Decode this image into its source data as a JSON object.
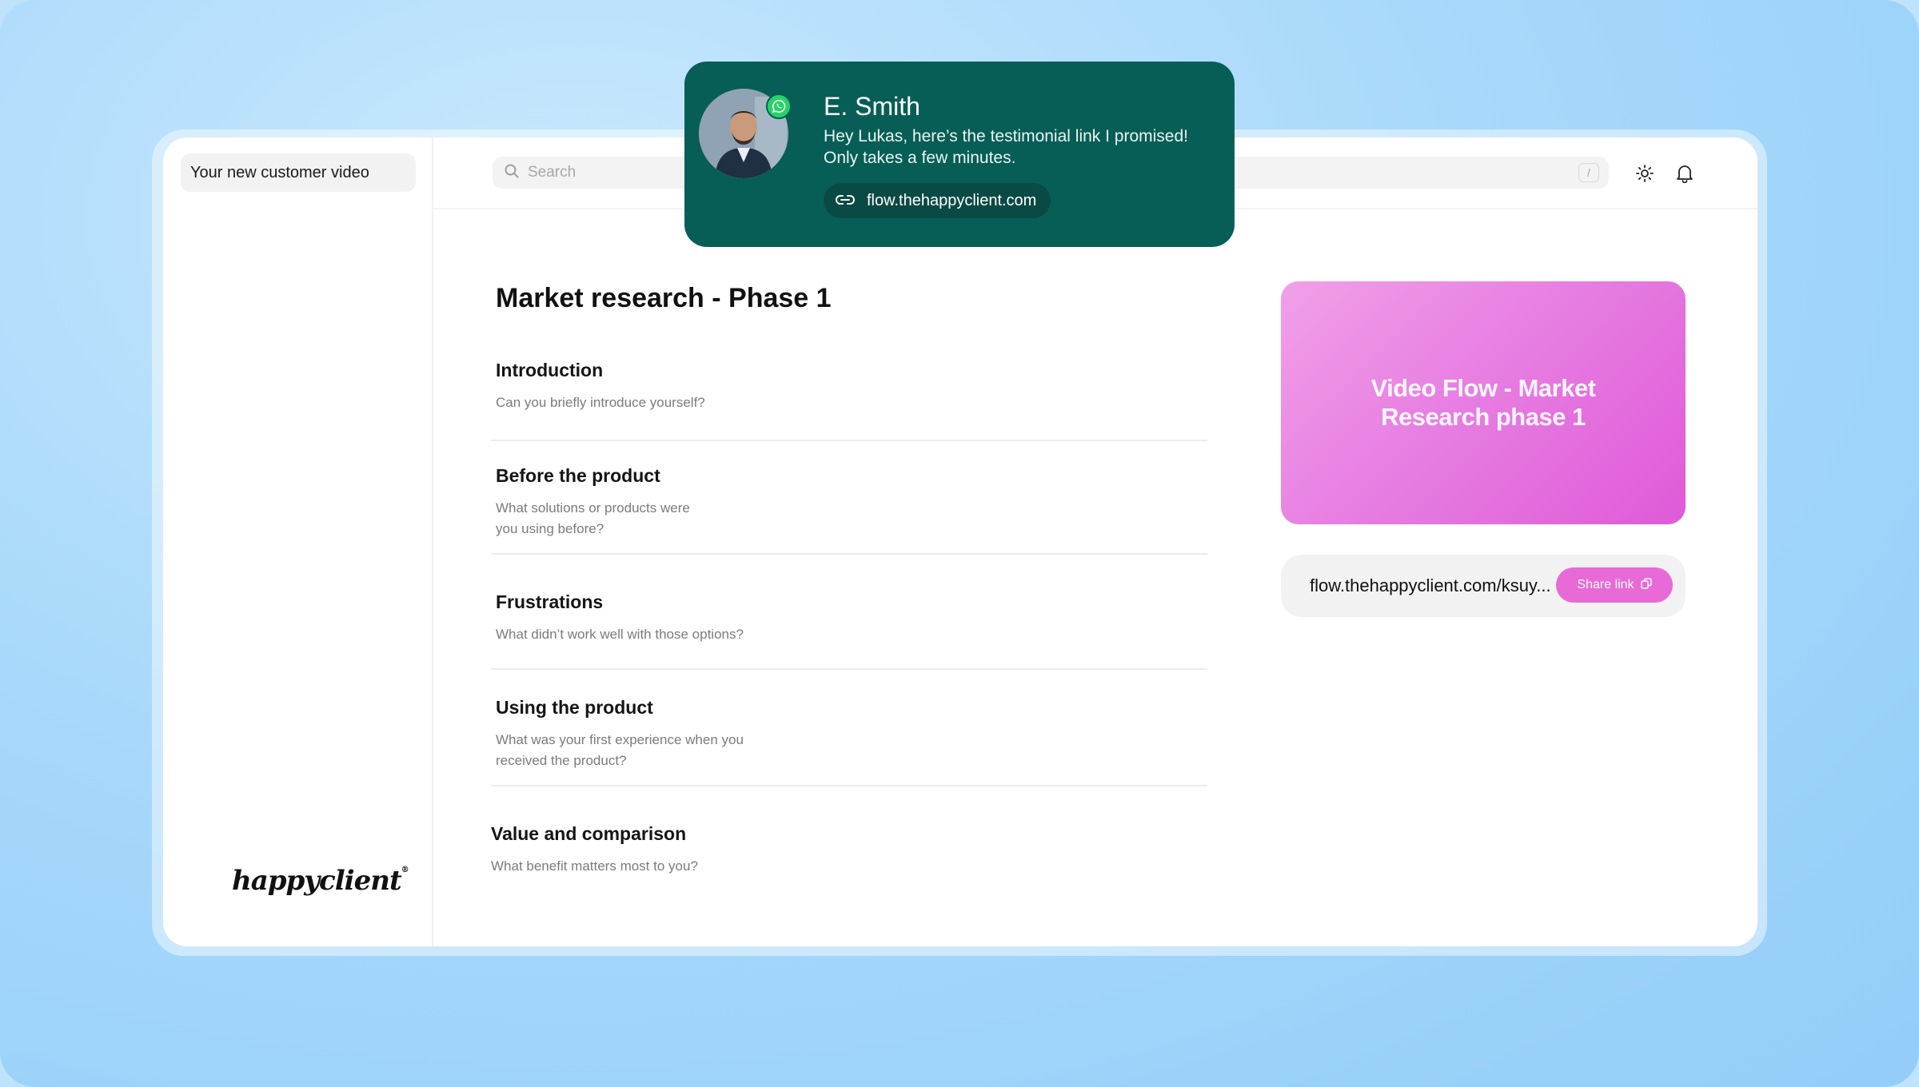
{
  "sidebar": {
    "workspace_label": "Your new customer video",
    "logo_text": "happyclient"
  },
  "topbar": {
    "search_placeholder": "Search",
    "shortcut_key": "/"
  },
  "main": {
    "title": "Market research - Phase 1",
    "sections": [
      {
        "heading": "Introduction",
        "question": "Can you briefly introduce yourself?"
      },
      {
        "heading": "Before the product",
        "question": "What solutions or products were\nyou using before?"
      },
      {
        "heading": "Frustrations",
        "question": "What didn’t work well with those options?"
      },
      {
        "heading": "Using the product",
        "question": "What was your first experience when you\nreceived the product?"
      },
      {
        "heading": "Value and comparison",
        "question": "What benefit matters most to you?"
      }
    ]
  },
  "preview": {
    "title": "Video Flow - Market Research phase 1",
    "share_url": "flow.thehappyclient.com/ksuy...",
    "share_button_label": "Share link"
  },
  "notification": {
    "sender": "E. Smith",
    "message": "Hey Lukas, here’s the testimonial link I promised! Only takes a few minutes.",
    "link": "flow.thehappyclient.com",
    "app_icon": "whatsapp-icon"
  },
  "colors": {
    "notification_bg": "#075e56",
    "accent_pink": "#e86ad6",
    "background": "#a9d9fb"
  }
}
